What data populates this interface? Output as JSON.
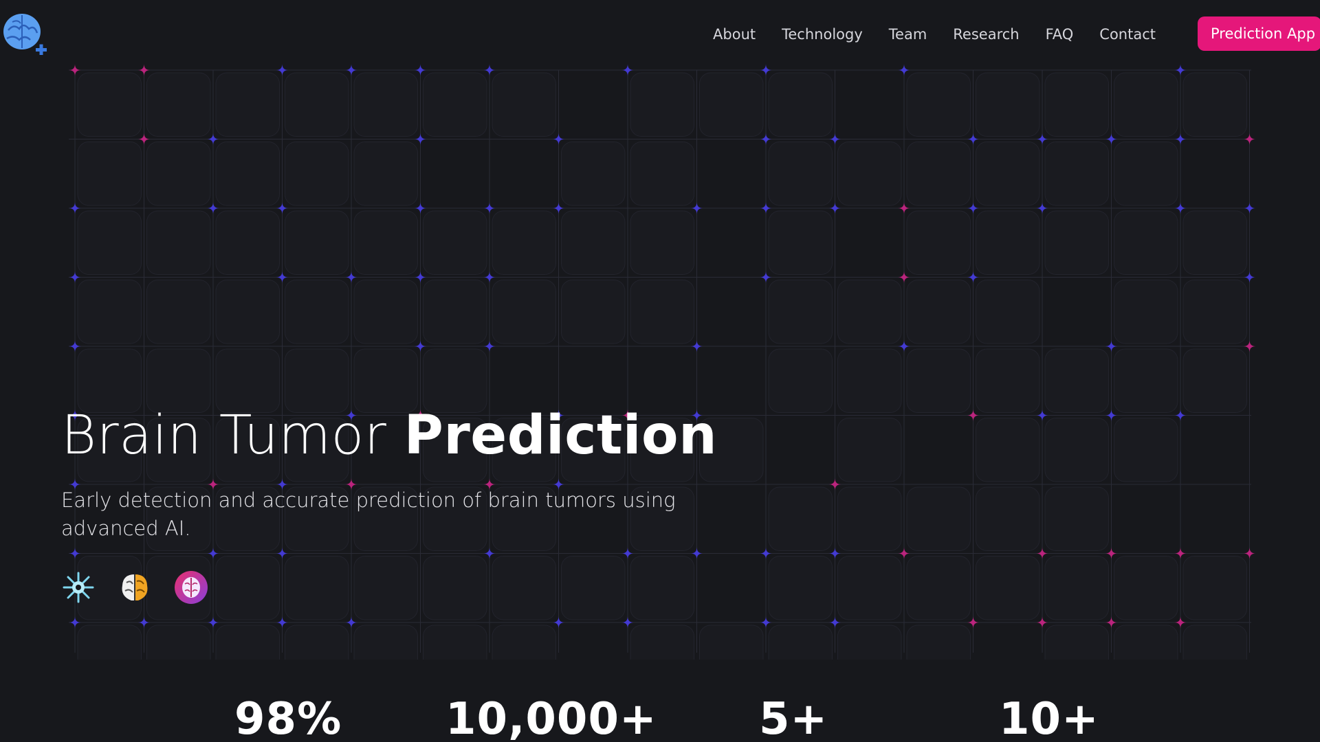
{
  "header": {
    "logo_icon": "brain-plus-icon",
    "nav": [
      {
        "label": "About"
      },
      {
        "label": "Technology"
      },
      {
        "label": "Team"
      },
      {
        "label": "Research"
      },
      {
        "label": "FAQ"
      },
      {
        "label": "Contact"
      }
    ],
    "cta_label": "Prediction App"
  },
  "hero": {
    "title_light": "Brain Tumor",
    "title_bold": "Prediction",
    "subtitle": "Early detection and accurate prediction of brain tumors using advanced AI.",
    "icons": [
      "brain-snowflake-icon",
      "brain-orange-icon",
      "brain-circle-icon"
    ]
  },
  "stats": [
    {
      "value": "98%"
    },
    {
      "value": "10,000+"
    },
    {
      "value": "5+"
    },
    {
      "value": "10+"
    }
  ],
  "colors": {
    "background": "#17181c",
    "accent": "#e5177a",
    "grid_blue": "#4a3ff0",
    "grid_pink": "#d6268c"
  }
}
